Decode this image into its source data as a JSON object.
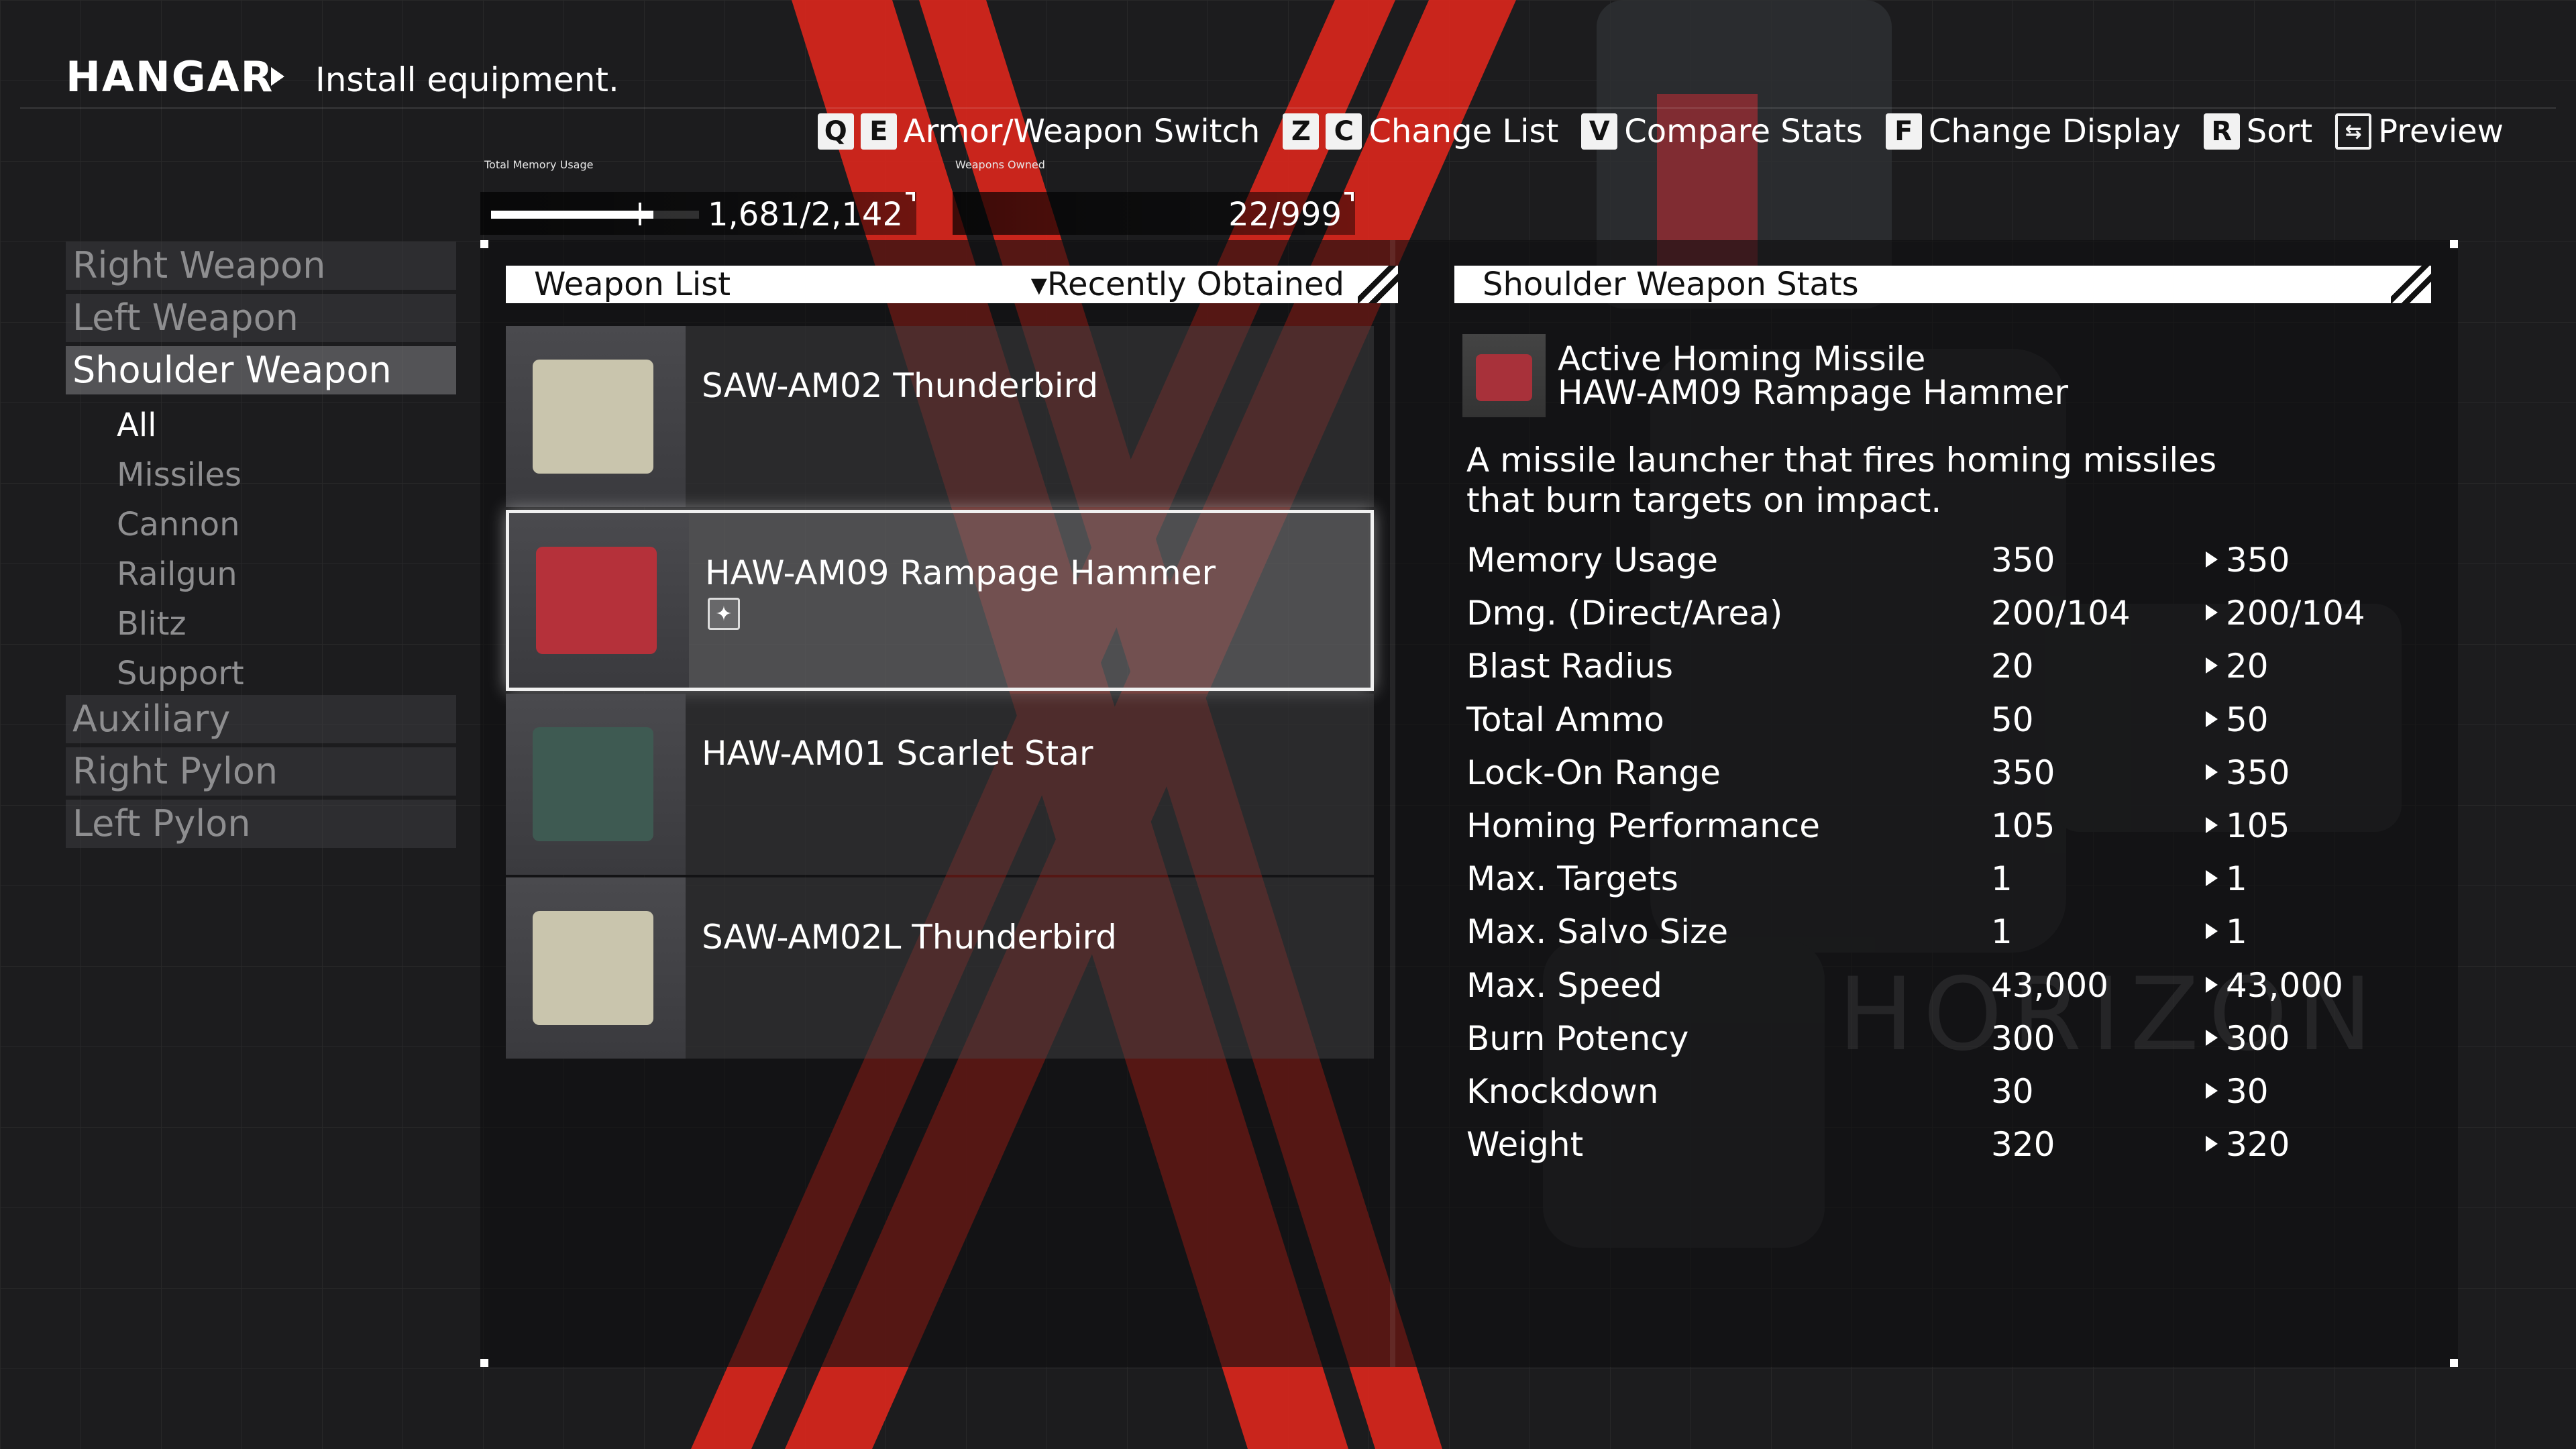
{
  "header": {
    "title": "HANGAR",
    "subtitle": "Install equipment."
  },
  "controls": [
    {
      "keys": [
        "Q",
        "E"
      ],
      "label": "Armor/Weapon Switch"
    },
    {
      "keys": [
        "Z",
        "C"
      ],
      "label": "Change List"
    },
    {
      "keys": [
        "V"
      ],
      "label": "Compare Stats"
    },
    {
      "keys": [
        "F"
      ],
      "label": "Change Display"
    },
    {
      "keys": [
        "R"
      ],
      "label": "Sort"
    },
    {
      "keys": [
        "preview-icon"
      ],
      "label": "Preview"
    }
  ],
  "memory": {
    "label": "Total Memory Usage",
    "value": "1,681/2,142",
    "fill_fraction": 0.78
  },
  "owned": {
    "label": "Weapons Owned",
    "value": "22/999"
  },
  "sidebar": {
    "items": [
      {
        "label": "Right Weapon",
        "active": false
      },
      {
        "label": "Left Weapon",
        "active": false
      },
      {
        "label": "Shoulder Weapon",
        "active": true
      },
      {
        "label": "Auxiliary",
        "active": false
      },
      {
        "label": "Right Pylon",
        "active": false
      },
      {
        "label": "Left Pylon",
        "active": false
      }
    ],
    "subitems": [
      {
        "label": "All",
        "active": true
      },
      {
        "label": "Missiles",
        "active": false
      },
      {
        "label": "Cannon",
        "active": false
      },
      {
        "label": "Railgun",
        "active": false
      },
      {
        "label": "Blitz",
        "active": false
      },
      {
        "label": "Support",
        "active": false
      }
    ]
  },
  "weapon_list": {
    "title": "Weapon List",
    "sort": "Recently Obtained",
    "items": [
      {
        "name": "SAW-AM02 Thunderbird",
        "selected": false,
        "badge": false,
        "thumb_color": "#c9c5ad"
      },
      {
        "name": "HAW-AM09 Rampage Hammer",
        "selected": true,
        "badge": true,
        "thumb_color": "#b5313a"
      },
      {
        "name": "HAW-AM01 Scarlet Star",
        "selected": false,
        "badge": false,
        "thumb_color": "#3e5a52"
      },
      {
        "name": "SAW-AM02L Thunderbird",
        "selected": false,
        "badge": false,
        "thumb_color": "#c9c5ad"
      }
    ]
  },
  "stats_panel": {
    "title": "Shoulder Weapon Stats",
    "type": "Active Homing Missile",
    "name": "HAW-AM09 Rampage Hammer",
    "description": "A missile launcher that fires homing missiles that burn targets on impact.",
    "rows": [
      {
        "label": "Memory Usage",
        "current": "350",
        "next": "350"
      },
      {
        "label": "Dmg. (Direct/Area)",
        "current": "200/104",
        "next": "200/104"
      },
      {
        "label": "Blast Radius",
        "current": "20",
        "next": "20"
      },
      {
        "label": "Total Ammo",
        "current": "50",
        "next": "50"
      },
      {
        "label": "Lock-On Range",
        "current": "350",
        "next": "350"
      },
      {
        "label": "Homing Performance",
        "current": "105",
        "next": "105"
      },
      {
        "label": "Max. Targets",
        "current": "1",
        "next": "1"
      },
      {
        "label": "Max. Salvo Size",
        "current": "1",
        "next": "1"
      },
      {
        "label": "Max. Speed",
        "current": "43,000",
        "next": "43,000"
      },
      {
        "label": "Burn Potency",
        "current": "300",
        "next": "300"
      },
      {
        "label": "Knockdown",
        "current": "30",
        "next": "30"
      },
      {
        "label": "Weight",
        "current": "320",
        "next": "320"
      }
    ]
  },
  "watermark": "HORIZON",
  "colors": {
    "accent_red": "#e0281e",
    "background": "#1b1b1d",
    "white": "#ffffff"
  }
}
